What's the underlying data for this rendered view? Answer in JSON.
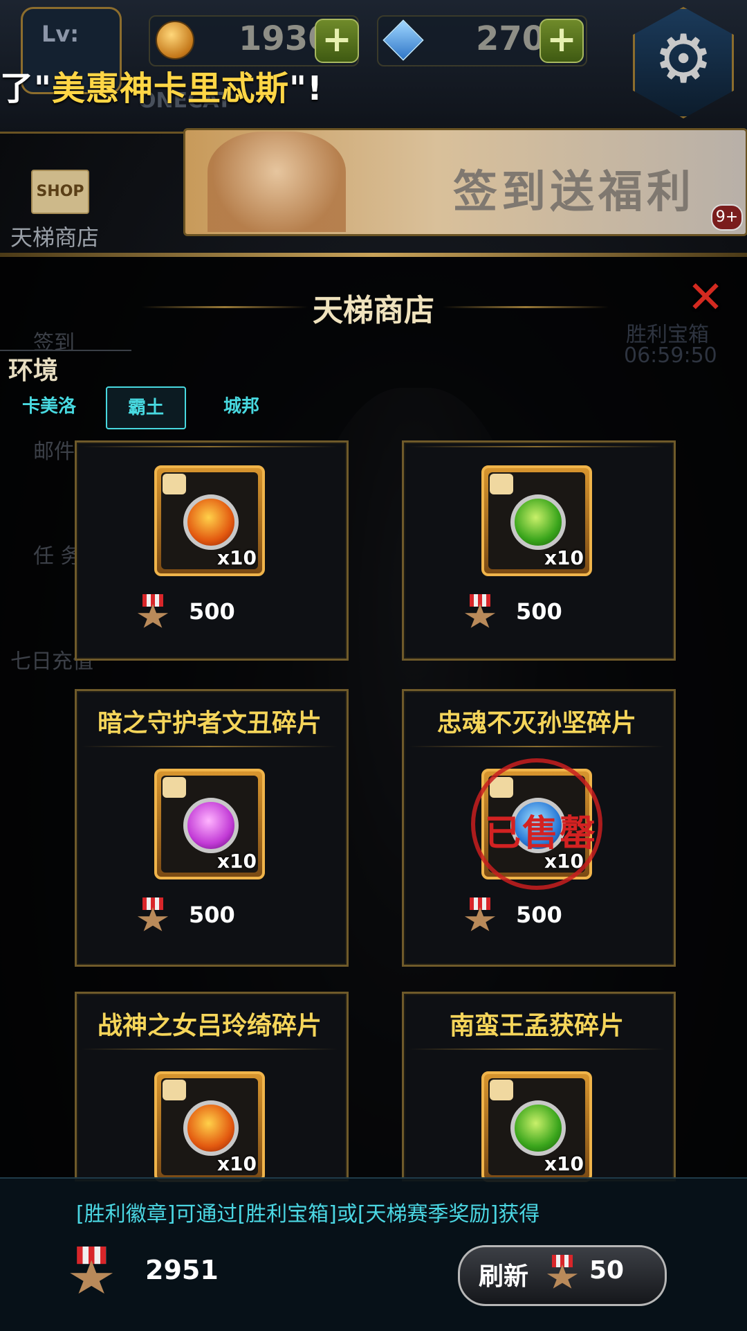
{
  "hud": {
    "level_label": "Lv:",
    "gold": "1930",
    "gems": "270",
    "plus": "+",
    "username": "ONECAT",
    "notice_prefix": "了\"",
    "notice_highlight": "美惠神卡里忒斯",
    "notice_suffix": "\"!"
  },
  "banner": {
    "text": "签到送福利",
    "badge": "9+"
  },
  "side_menu": {
    "shop_sign": "SHOP",
    "shop_label": "天梯商店",
    "checkin": "签到",
    "mail": "邮件",
    "tasks": "任 务",
    "recharge": "七日充值"
  },
  "modal": {
    "title": "天梯商店",
    "close": "✕",
    "chest_label": "胜利宝箱",
    "chest_timer": "06:59:50",
    "env_label": "环境",
    "tabs": [
      {
        "label": "卡美洛",
        "active": false
      },
      {
        "label": "霸土",
        "active": true
      },
      {
        "label": "城邦",
        "active": false
      }
    ]
  },
  "items": [
    {
      "name": "",
      "element": "fire",
      "qty": "x10",
      "price": "500",
      "sold": false
    },
    {
      "name": "",
      "element": "wood",
      "qty": "x10",
      "price": "500",
      "sold": false
    },
    {
      "name": "暗之守护者文丑碎片",
      "element": "dark",
      "qty": "x10",
      "price": "500",
      "sold": false
    },
    {
      "name": "忠魂不灭孙坚碎片",
      "element": "water",
      "qty": "x10",
      "price": "500",
      "sold": true,
      "sold_label": "已售罄"
    },
    {
      "name": "战神之女吕玲绮碎片",
      "element": "fire",
      "qty": "x10",
      "price": "",
      "sold": false
    },
    {
      "name": "南蛮王孟获碎片",
      "element": "wood",
      "qty": "x10",
      "price": "",
      "sold": false
    }
  ],
  "footer": {
    "hint": "[胜利徽章]可通过[胜利宝箱]或[天梯赛季奖励]获得",
    "balance": "2951",
    "refresh_label": "刷新",
    "refresh_cost": "50"
  },
  "colors": {
    "accent_gold": "#f5d55a",
    "tab_cyan": "#48d9e0",
    "close_red": "#d42a20",
    "frame_gold": "#6f5a2a"
  },
  "icons": {
    "gold": "coin-icon",
    "gems": "diamond-icon",
    "settings": "gear-icon",
    "close": "close-icon",
    "currency": "victory-medal-icon"
  }
}
